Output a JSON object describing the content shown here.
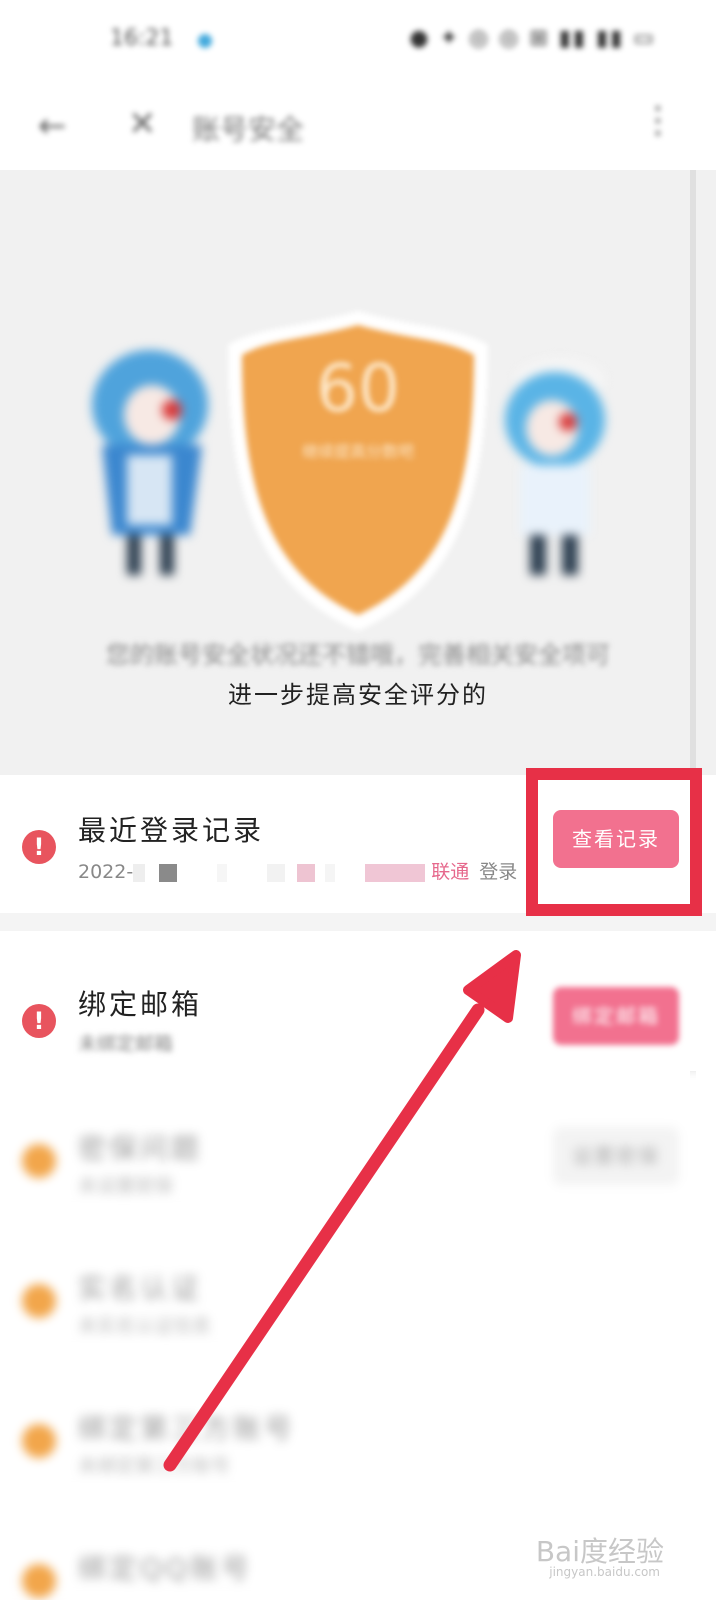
{
  "status": {
    "time": "16:21",
    "right": "● ✦ ◎ ◎ ⊞ ▮▮ ▮▮ ▭"
  },
  "appbar": {
    "back": "←",
    "close": "✕",
    "title": "账号安全",
    "more": "⋮"
  },
  "hero": {
    "score": "60",
    "score_sub": "继续提高分数吧",
    "text1": "您的账号安全状况还不错哦，完善相关安全项可",
    "text2": "进一步提高安全评分的"
  },
  "rows": [
    {
      "title": "最近登录记录",
      "sub_prefix": "2022-",
      "carrier": "联通",
      "sub_suffix": "登录",
      "button": "查看记录",
      "status": "alert"
    },
    {
      "title": "绑定邮箱",
      "sub": "未绑定邮箱",
      "button": "绑定邮箱",
      "status": "alert"
    },
    {
      "title": "密保问题",
      "sub": "未设置密保",
      "button": "设置密保",
      "status": "warning"
    },
    {
      "title": "实名认证",
      "sub": "未实名认证信息",
      "status": "warning"
    },
    {
      "title": "绑定第三方账号",
      "sub": "未绑定第三方账号",
      "status": "warning"
    },
    {
      "title": "绑定QQ账号",
      "status": "warning"
    }
  ],
  "watermark": {
    "logo": "Bai度经验",
    "site": "jingyan.baidu.com"
  },
  "colors": {
    "accent": "#f2718f",
    "alert": "#e8545e",
    "warning": "#f2a64b",
    "highlight": "#e73047"
  }
}
